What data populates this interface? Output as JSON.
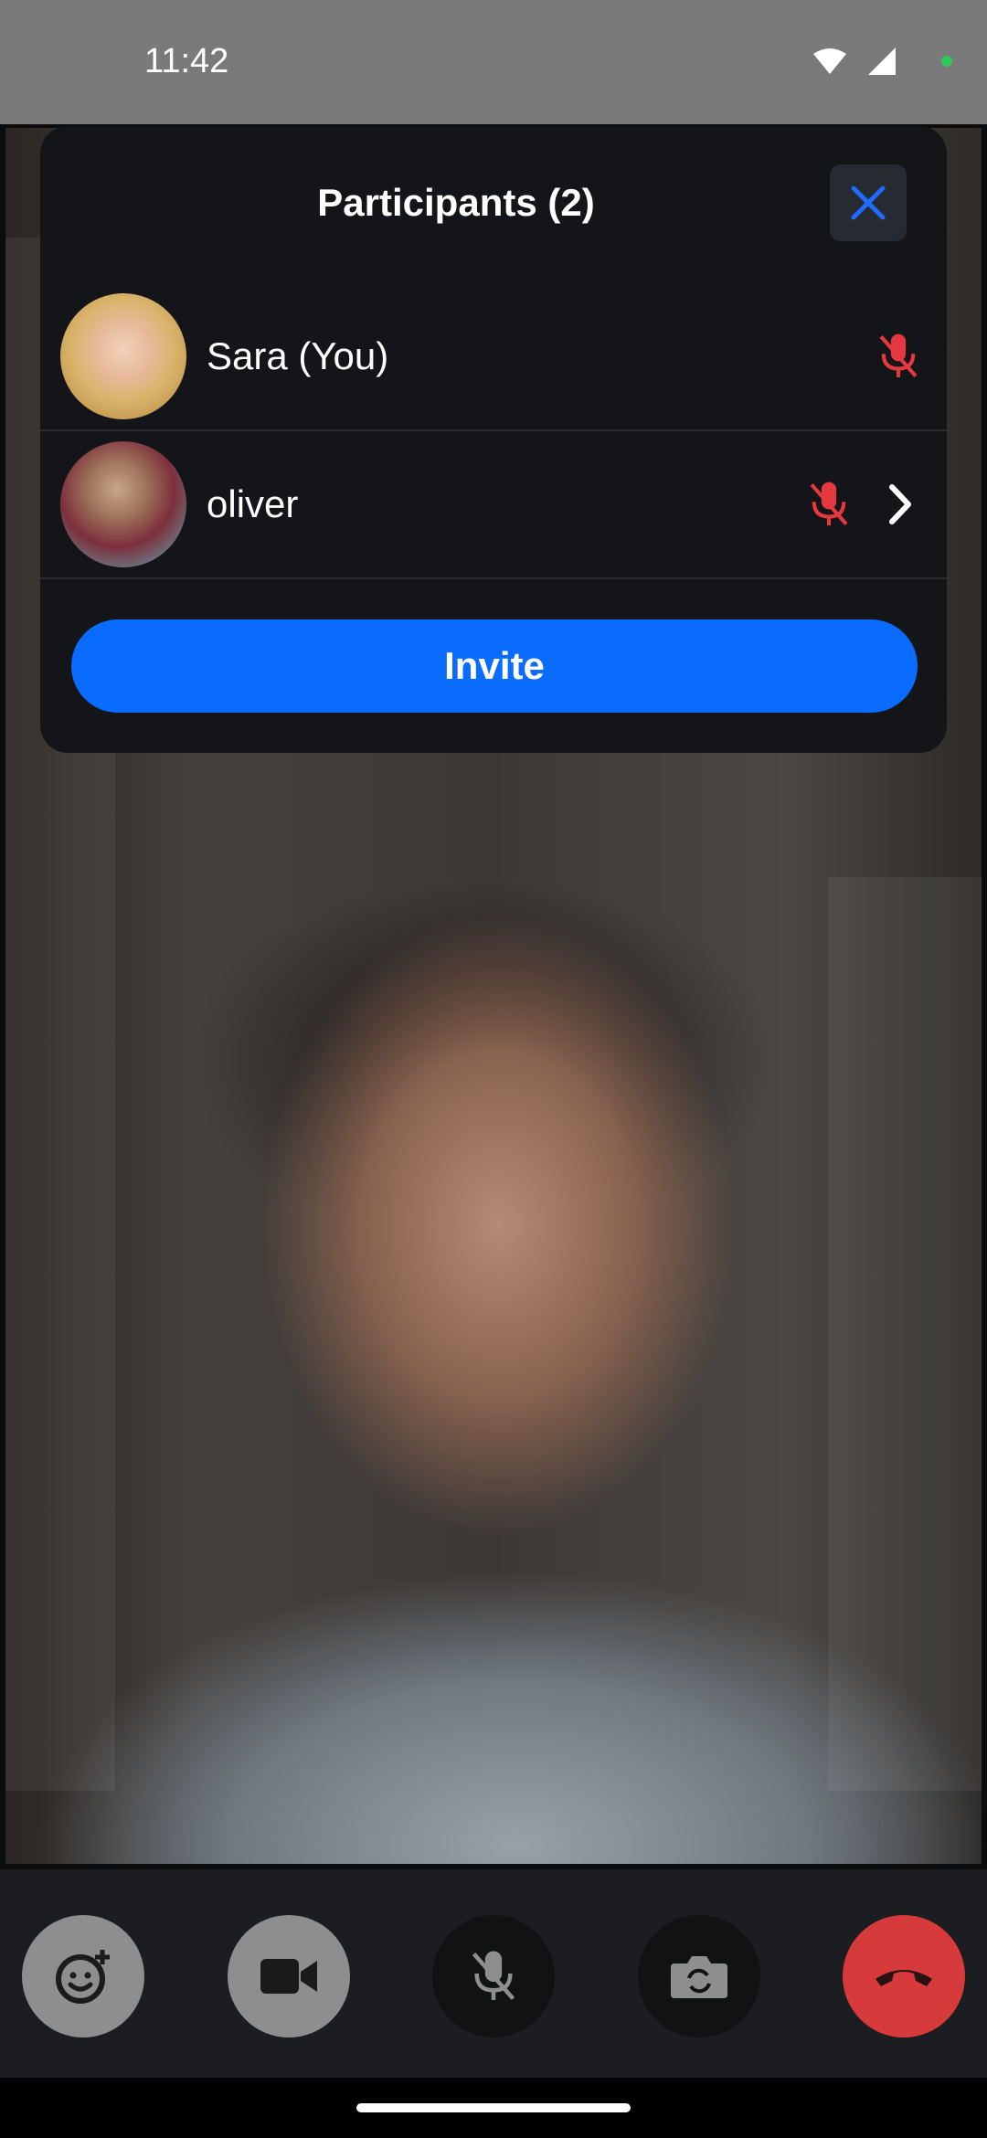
{
  "status_bar": {
    "time": "11:42"
  },
  "panel": {
    "title": "Participants (2)",
    "participants": [
      {
        "name": "Sara (You)",
        "muted": true
      },
      {
        "name": "oliver",
        "muted": true
      }
    ],
    "invite_label": "Invite"
  },
  "video": {
    "speaker_name": "oliver"
  },
  "colors": {
    "accent": "#0a6cff",
    "muted_red": "#e5393f",
    "end_call": "#d63a3a"
  },
  "controls": [
    "emoji-add-icon",
    "video-camera-icon",
    "mic-off-icon",
    "switch-camera-icon",
    "end-call-icon"
  ]
}
